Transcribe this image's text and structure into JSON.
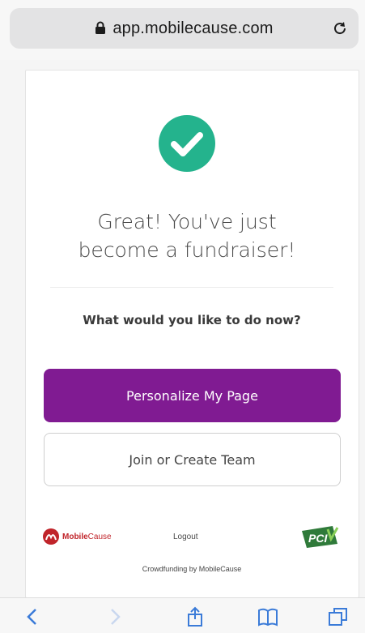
{
  "browser": {
    "url": "app.mobilecause.com",
    "icons": [
      "lock-icon",
      "reload-icon"
    ]
  },
  "card": {
    "headline_line1": "Great! You've just",
    "headline_line2": "become a fundraiser!",
    "question": "What would you like to do now?",
    "primary_button": "Personalize My Page",
    "secondary_button": "Join or Create Team"
  },
  "footer": {
    "logo_bold": "Mobile",
    "logo_light": "Cause",
    "logout": "Logout",
    "pci_label": "PCI",
    "crowdfunding": "Crowdfunding by MobileCause"
  },
  "toolbar": {
    "icons": [
      "back-icon",
      "forward-icon",
      "share-icon",
      "bookmarks-icon",
      "tabs-icon"
    ]
  },
  "colors": {
    "accent_purple": "#801b92",
    "check_green": "#24b38d",
    "brand_red": "#c0242a",
    "ios_blue": "#3b7bd8"
  }
}
